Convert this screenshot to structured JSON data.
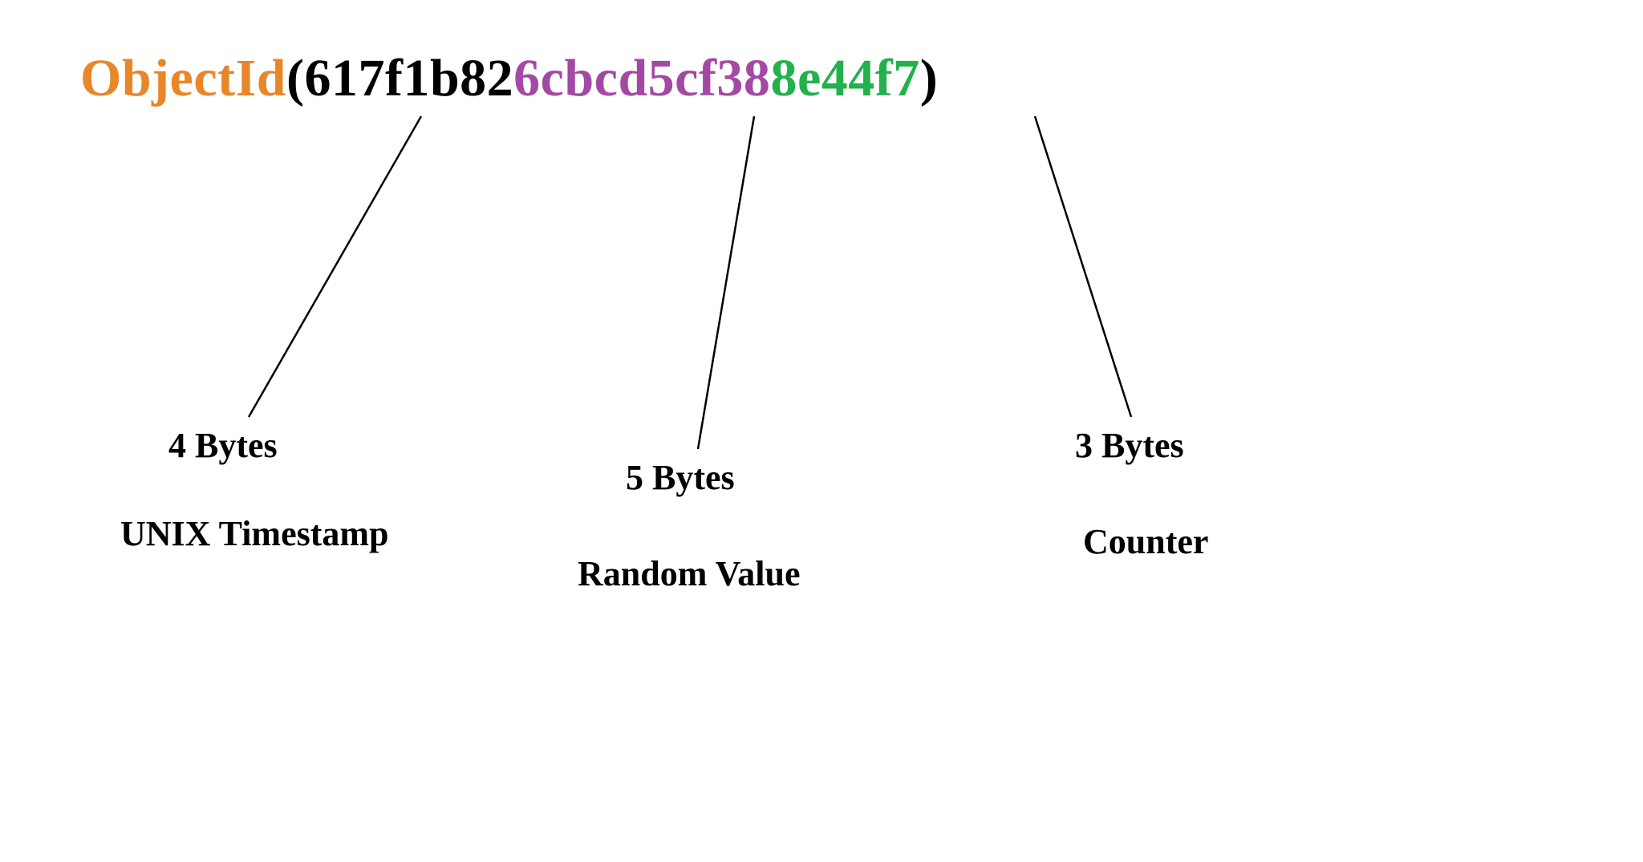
{
  "objectid": {
    "prefix": "ObjectId",
    "paren_open": "(",
    "timestamp_hex": "617f1b82",
    "random_hex": "6cbcd5cf38",
    "counter_hex": "8e44f7",
    "paren_close": ")"
  },
  "segments": {
    "timestamp": {
      "bytes_label": "4 Bytes",
      "desc_label": "UNIX Timestamp",
      "color": "#000000"
    },
    "random": {
      "bytes_label": "5 Bytes",
      "desc_label": "Random Value",
      "color": "#a349a4"
    },
    "counter": {
      "bytes_label": "3 Bytes",
      "desc_label": "Counter",
      "color": "#22b14c"
    }
  },
  "colors": {
    "prefix": "#e8862a",
    "paren": "#000000",
    "timestamp": "#000000",
    "random": "#a349a4",
    "counter": "#22b14c"
  }
}
